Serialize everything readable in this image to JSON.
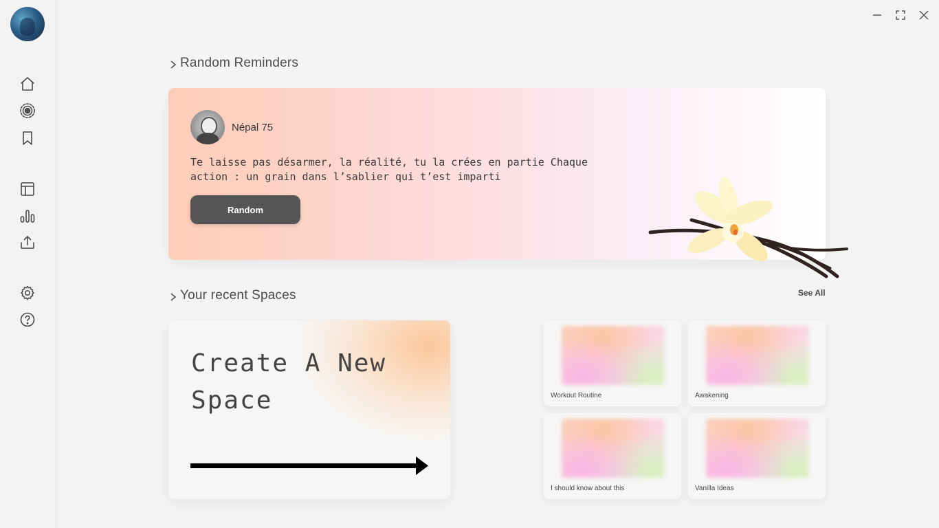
{
  "sidebar": {
    "nav": [
      {
        "name": "home-icon"
      },
      {
        "name": "target-icon"
      },
      {
        "name": "bookmark-icon"
      },
      {
        "name": "layout-icon"
      },
      {
        "name": "bar-chart-icon"
      },
      {
        "name": "share-icon"
      },
      {
        "name": "settings-icon"
      },
      {
        "name": "help-icon"
      }
    ]
  },
  "window_controls": [
    "minimize-icon",
    "maximize-icon",
    "close-icon"
  ],
  "reminders": {
    "section_title": "Random Reminders",
    "author": "Népal 75",
    "quote_line1": "Te laisse pas désarmer, la réalité, tu la crées en partie Chaque",
    "quote_line2": "action : un grain dans l’sablier qui t’est imparti",
    "button_label": "Random"
  },
  "spaces": {
    "section_title": "Your recent Spaces",
    "see_all_label": "See All",
    "create_line1": "Create A New",
    "create_line2": "Space",
    "items": [
      {
        "label": "Workout Routine"
      },
      {
        "label": "Awakening"
      },
      {
        "label": "I should know about this"
      },
      {
        "label": "Vanilla Ideas"
      }
    ]
  },
  "colors": {
    "background": "#f4f4f4",
    "button": "#555555",
    "card_gradient_start": "#fdcdb8",
    "card_gradient_end": "#ffffff"
  }
}
